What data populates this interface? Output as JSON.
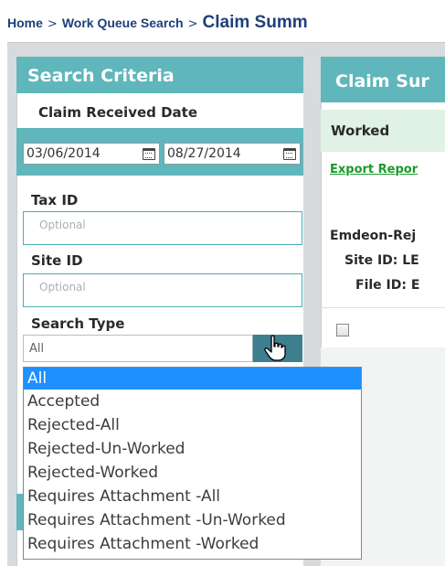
{
  "breadcrumb": {
    "home": "Home",
    "separator": ">",
    "work_queue": "Work Queue Search",
    "current": "Claim Summ"
  },
  "search_panel": {
    "title": "Search Criteria",
    "date_section_title": "Claim Received Date",
    "start_date": "03/06/2014",
    "end_date": "08/27/2014",
    "tax_id_label": "Tax ID",
    "tax_id_placeholder": "Optional",
    "site_id_label": "Site ID",
    "site_id_placeholder": "Optional",
    "search_type_label": "Search Type",
    "search_type_value": "All"
  },
  "dropdown": {
    "options": [
      "All",
      "Accepted",
      "Rejected-All",
      "Rejected-Un-Worked",
      "Rejected-Worked",
      "Requires Attachment -All",
      "Requires Attachment -Un-Worked",
      "Requires Attachment -Worked"
    ],
    "selected_index": 0
  },
  "summary_panel": {
    "title": "Claim Sur",
    "worked_label": "Worked",
    "export_link": "Export Repor",
    "emdeon_label": "Emdeon-Rej",
    "site_id_text": "Site ID: LE",
    "file_id_text": "File ID: E"
  },
  "colors": {
    "teal_header": "#5fb6bb",
    "breadcrumb_text": "#1f3f7a",
    "selected_option": "#1e90ff",
    "export_link": "#1a9a2c"
  }
}
